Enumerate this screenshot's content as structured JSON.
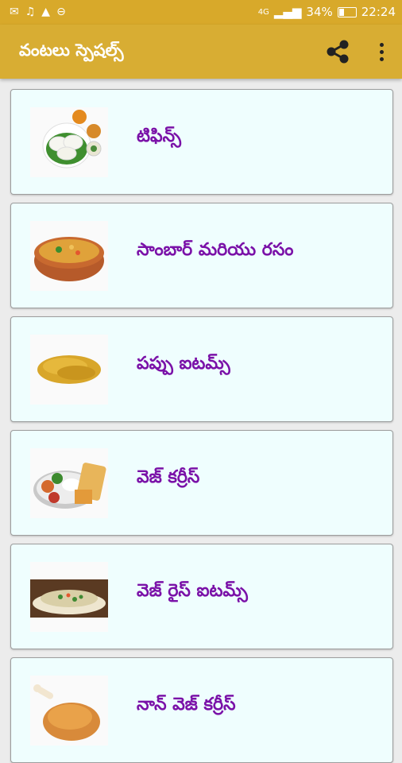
{
  "status_bar": {
    "left_icons": [
      "mail-icon",
      "music-icon",
      "warning-icon",
      "minus-circle-icon"
    ],
    "signal_text": "4G",
    "battery": "34%",
    "time": "22:24"
  },
  "app_bar": {
    "title": "వంటలు స్పెషల్స్",
    "share_icon": "share-icon",
    "menu_icon": "more-vert-icon"
  },
  "colors": {
    "accent": "#d8ad33",
    "card_bg": "#effefe",
    "label": "#7a11a8"
  },
  "categories": [
    {
      "label": "టిఫిన్స్",
      "image": "idli-plate"
    },
    {
      "label": "సాంబార్ మరియు రసం",
      "image": "sambar-bowl"
    },
    {
      "label": "పప్పు ఐటమ్స్",
      "image": "dal-grains"
    },
    {
      "label": "వెజ్ కర్రీస్",
      "image": "veg-thali"
    },
    {
      "label": "వెజ్ రైస్ ఐటమ్స్",
      "image": "veg-rice"
    },
    {
      "label": "నాన్ వెజ్ కర్రీస్",
      "image": "chicken"
    }
  ]
}
